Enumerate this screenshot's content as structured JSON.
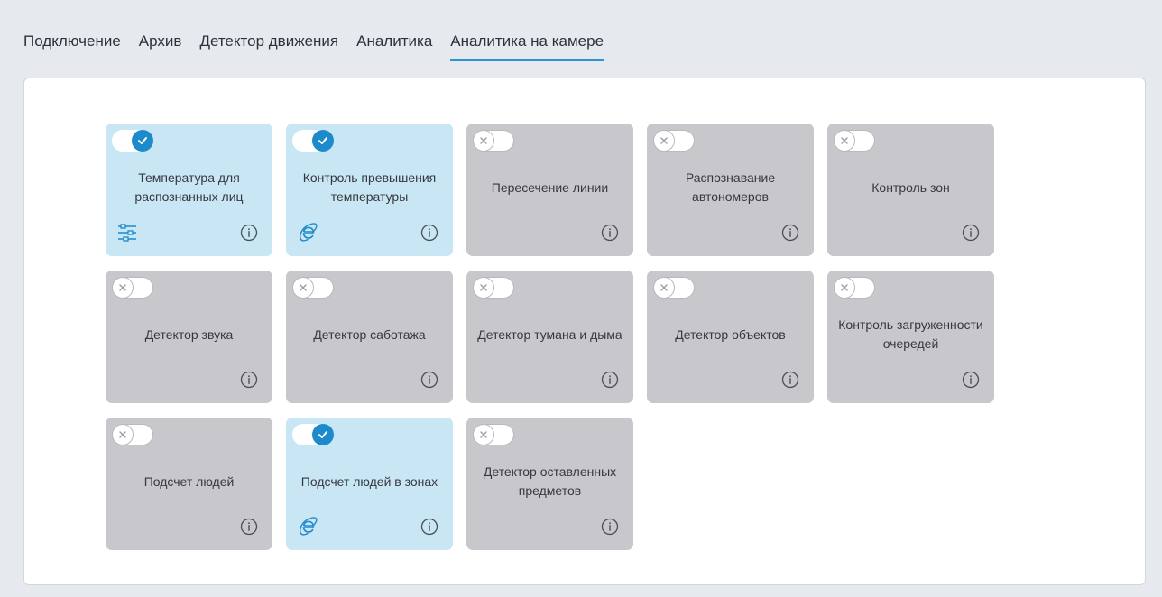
{
  "tabs": [
    {
      "label": "Подключение",
      "active": false
    },
    {
      "label": "Архив",
      "active": false
    },
    {
      "label": "Детектор движения",
      "active": false
    },
    {
      "label": "Аналитика",
      "active": false
    },
    {
      "label": "Аналитика на камере",
      "active": true
    }
  ],
  "colors": {
    "accent": "#1d8acb",
    "card_on": "#c9e6f4",
    "card_off": "#c8c8cc"
  },
  "cards": [
    {
      "label": "Температура для распознанных лиц",
      "enabled": true,
      "icon": "settings-sliders-icon"
    },
    {
      "label": "Контроль превышения температуры",
      "enabled": true,
      "icon": "browser-e-icon"
    },
    {
      "label": "Пересечение линии",
      "enabled": false
    },
    {
      "label": "Распознавание автономеров",
      "enabled": false
    },
    {
      "label": "Контроль зон",
      "enabled": false
    },
    {
      "label": "Детектор звука",
      "enabled": false
    },
    {
      "label": "Детектор саботажа",
      "enabled": false
    },
    {
      "label": "Детектор тумана и дыма",
      "enabled": false
    },
    {
      "label": "Детектор объектов",
      "enabled": false
    },
    {
      "label": "Контроль загруженности очередей",
      "enabled": false
    },
    {
      "label": "Подсчет людей",
      "enabled": false
    },
    {
      "label": "Подсчет людей в зонах",
      "enabled": true,
      "icon": "browser-e-icon"
    },
    {
      "label": "Детектор оставленных предметов",
      "enabled": false
    }
  ]
}
